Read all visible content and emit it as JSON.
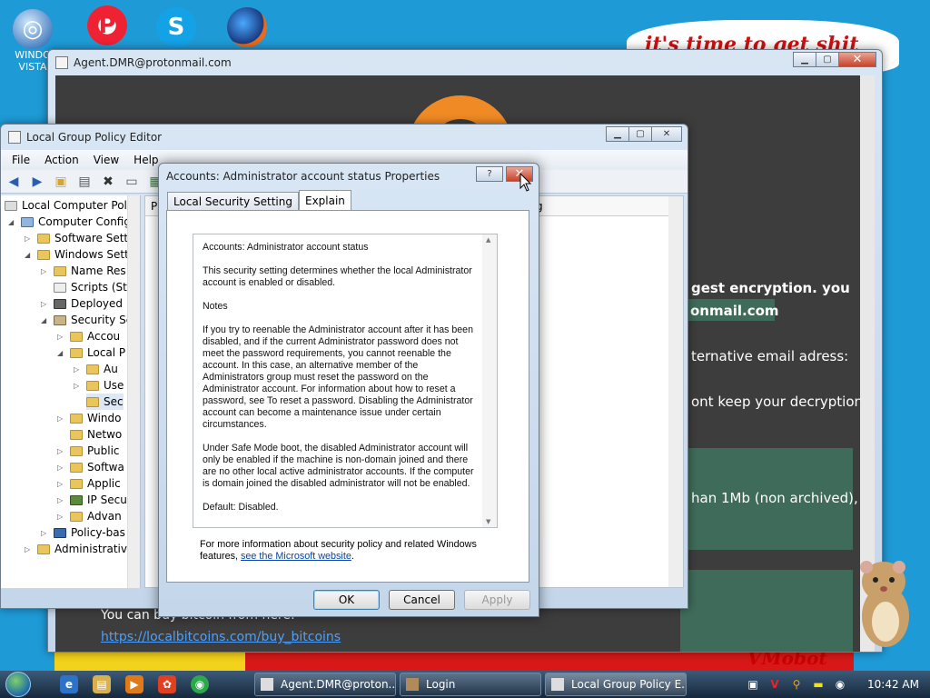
{
  "desktop": {
    "icons": [
      {
        "label": "WINDO VISTA"
      }
    ],
    "wallpaper_text": "it's time to get shit",
    "wallpaper_logo": "VMobot"
  },
  "browser": {
    "title": "Agent.DMR@protonmail.com",
    "lines": [
      "!",
      "gest encryption. you",
      "onmail.com",
      "ternative email adress:",
      "ont keep your decryption",
      "han 1Mb (non archived),",
      "You can buy bitcoin from here:"
    ],
    "link": "https://localbitcoins.com/buy_bitcoins"
  },
  "gpo": {
    "title": "Local Group Policy Editor",
    "menu": [
      "File",
      "Action",
      "View",
      "Help"
    ],
    "tree": [
      {
        "label": "Local Computer Polic"
      },
      {
        "label": "Computer Config"
      },
      {
        "label": "Software Setti"
      },
      {
        "label": "Windows Sett"
      },
      {
        "label": "Name Res"
      },
      {
        "label": "Scripts (Sta"
      },
      {
        "label": "Deployed"
      },
      {
        "label": "Security Se"
      },
      {
        "label": "Accou"
      },
      {
        "label": "Local P"
      },
      {
        "label": "Au"
      },
      {
        "label": "Use"
      },
      {
        "label": "Sec"
      },
      {
        "label": "Windo"
      },
      {
        "label": "Netwo"
      },
      {
        "label": "Public"
      },
      {
        "label": "Softwa"
      },
      {
        "label": "Applic"
      },
      {
        "label": "IP Secu"
      },
      {
        "label": "Advan"
      },
      {
        "label": "Policy-bas"
      },
      {
        "label": "Administrativ"
      }
    ],
    "header_frag_left": "P",
    "header_frag_right": "g"
  },
  "dialog": {
    "title": "Accounts: Administrator account status Properties",
    "help_label": "?",
    "close_label": "✕",
    "tabs": [
      "Local Security Setting",
      "Explain"
    ],
    "explain": [
      "Accounts: Administrator account status",
      "This security setting determines whether the local Administrator account is enabled or disabled.",
      "Notes",
      "If you try to reenable the Administrator account after it has been disabled, and if the current Administrator password does not meet the password requirements, you cannot reenable the account. In this case, an alternative member of the Administrators group must reset the password on the Administrator account. For information about how to reset a password, see To reset a password. Disabling the Administrator account can become a maintenance issue under certain circumstances.",
      "Under Safe Mode boot, the disabled Administrator account will only be enabled if the machine is non-domain joined and there are no other local active administrator accounts.  If the computer is domain joined the disabled administrator will not be enabled.",
      "Default: Disabled."
    ],
    "more_info_prefix": "For more information about security policy and related Windows features, ",
    "more_info_link": "see the Microsoft website",
    "more_info_suffix": ".",
    "buttons": {
      "ok": "OK",
      "cancel": "Cancel",
      "apply": "Apply"
    }
  },
  "taskbar": {
    "tasks": [
      {
        "label": "Agent.DMR@proton..."
      },
      {
        "label": "Login"
      },
      {
        "label": "Local Group Policy E..."
      }
    ],
    "clock": "10:42 AM"
  },
  "colors": {
    "desktop": "#1e9bd7",
    "orange": "#f08a25",
    "red_close": "#c7432a"
  }
}
